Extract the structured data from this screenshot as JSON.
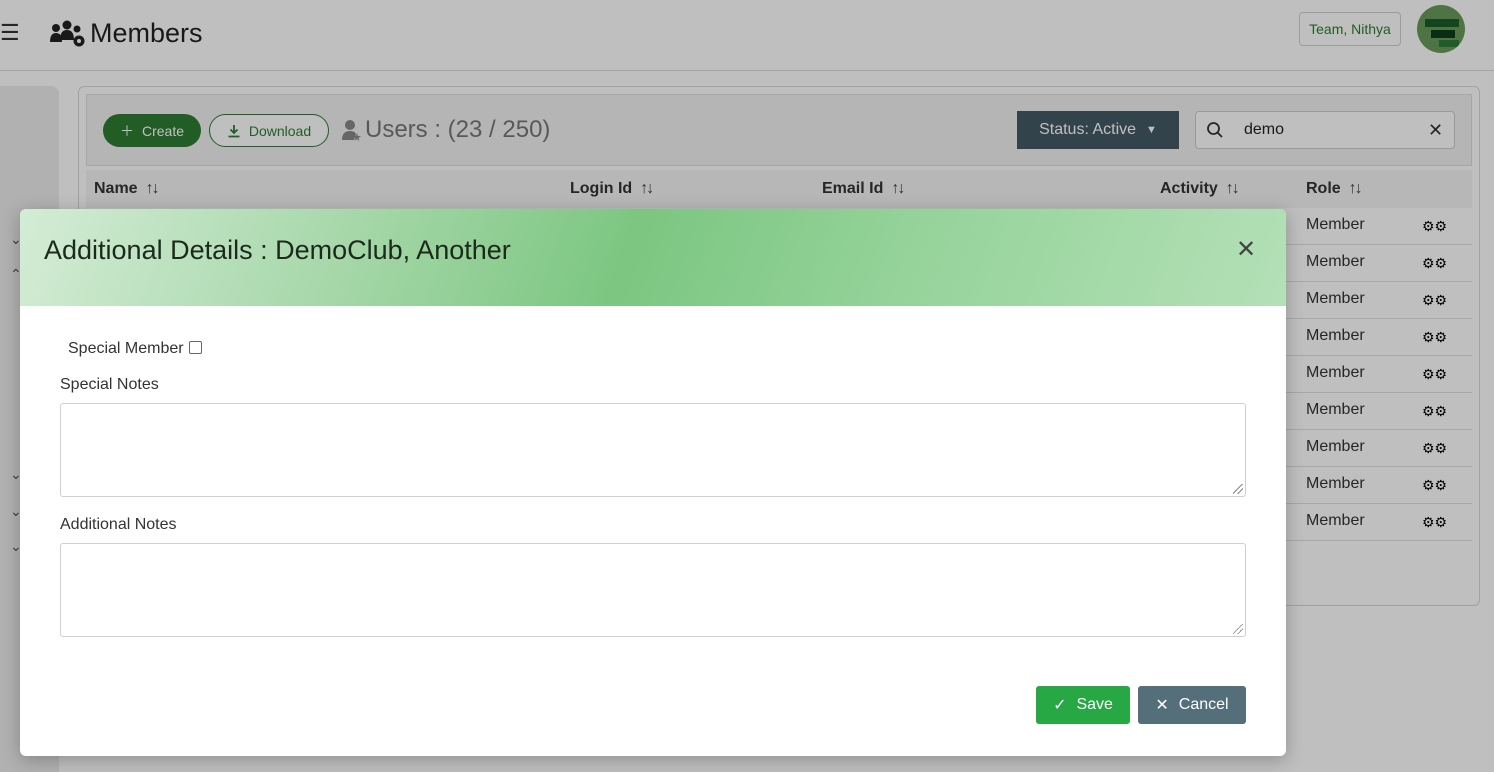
{
  "header": {
    "title": "Members",
    "team_label": "Team, Nithya",
    "icons": {
      "menu": "hamburger-icon",
      "page": "users-gear-icon"
    }
  },
  "toolbar": {
    "create_label": "Create",
    "download_label": "Download",
    "users_count": "Users : (23 / 250)",
    "status_label": "Status: Active",
    "search_value": "demo"
  },
  "table": {
    "columns": [
      "Name",
      "Login Id",
      "Email Id",
      "Activity",
      "Role"
    ],
    "rows": [
      {
        "role": "Member"
      },
      {
        "role": "Member"
      },
      {
        "role": "Member"
      },
      {
        "role": "Member"
      },
      {
        "role": "Member"
      },
      {
        "role": "Member"
      },
      {
        "role": "Member"
      },
      {
        "role": "Member"
      },
      {
        "role": "Member"
      }
    ]
  },
  "modal": {
    "title": "Additional Details : DemoClub, Another",
    "special_member_label": "Special Member",
    "special_member_checked": false,
    "special_notes_label": "Special Notes",
    "special_notes_value": "",
    "additional_notes_label": "Additional Notes",
    "additional_notes_value": "",
    "save_label": "Save",
    "cancel_label": "Cancel"
  },
  "colors": {
    "primary_green": "#2e7d32",
    "save_green": "#28a745",
    "cancel_slate": "#546e7a",
    "status_slate": "#455a64"
  }
}
